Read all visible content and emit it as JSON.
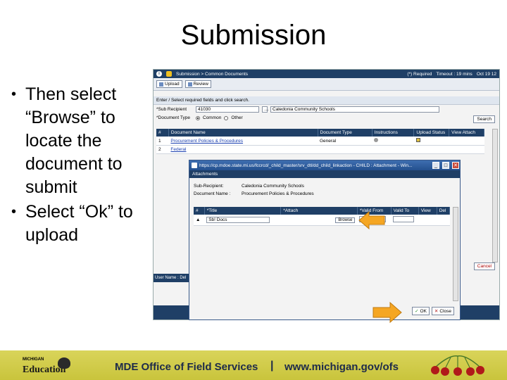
{
  "slide": {
    "title": "Submission",
    "bullets": [
      "Then select “Browse” to locate the document to submit",
      "Select “Ok” to upload"
    ]
  },
  "app": {
    "breadcrumb": "Submission > Common Documents",
    "required_note": "(*) Required",
    "timeout": "Timeout : 19 mins",
    "date": "Oct 19 12",
    "toolbar": {
      "upload": "Upload",
      "review": "Review"
    },
    "search_section": "Enter / Select required fields and click search.",
    "sub_recipient_label": "*Sub Recipient",
    "sub_recipient_code": "41030",
    "sub_recipient_name": "Caledonia Community Schools",
    "doc_type_label": "*Document Type",
    "doc_type_options": [
      "Common",
      "Other"
    ],
    "search_button": "Search",
    "grid_headers": [
      "#",
      "Document Name",
      "Document Type",
      "Instructions",
      "Upload Status",
      "View Attach"
    ],
    "rows": [
      {
        "num": "1",
        "name": "Procurement Policies & Procedures",
        "type": "General"
      },
      {
        "num": "2",
        "name": "Federal"
      }
    ],
    "cancel_button": "Cancel",
    "user_name_label": "User Name : Del"
  },
  "dialog": {
    "window_title": "https://cp.mdoe.state.mi.us/fccrcd/_child_master/srv_dtl/dd_child_linkaction - CHILD : Attachment - Win...",
    "header": "Attachments",
    "sub_recipient_label": "Sub-Recipient:",
    "sub_recipient_value": "Caledonia Community Schools",
    "document_name_label": "Document Name :",
    "document_name_value": "Procurement Policies & Procedures",
    "grid_headers": [
      "#",
      "*Title",
      "*Attach",
      "*Valid From",
      "Valid To",
      "View",
      "Del"
    ],
    "row": {
      "title": "Sb! Docs",
      "browse": "Browse"
    },
    "ok_button": "OK",
    "close_button": "Close"
  },
  "footer": {
    "logo_top": "MICHIGAN",
    "logo_bottom": "Education",
    "office": "MDE Office of Field Services",
    "separator": "|",
    "url": "www.michigan.gov/ofs"
  },
  "colors": {
    "navy": "#1f3f66",
    "footer_yellow": "#d9d45a",
    "arrow_orange": "#f5a623",
    "cherry_red": "#b01a1a"
  }
}
